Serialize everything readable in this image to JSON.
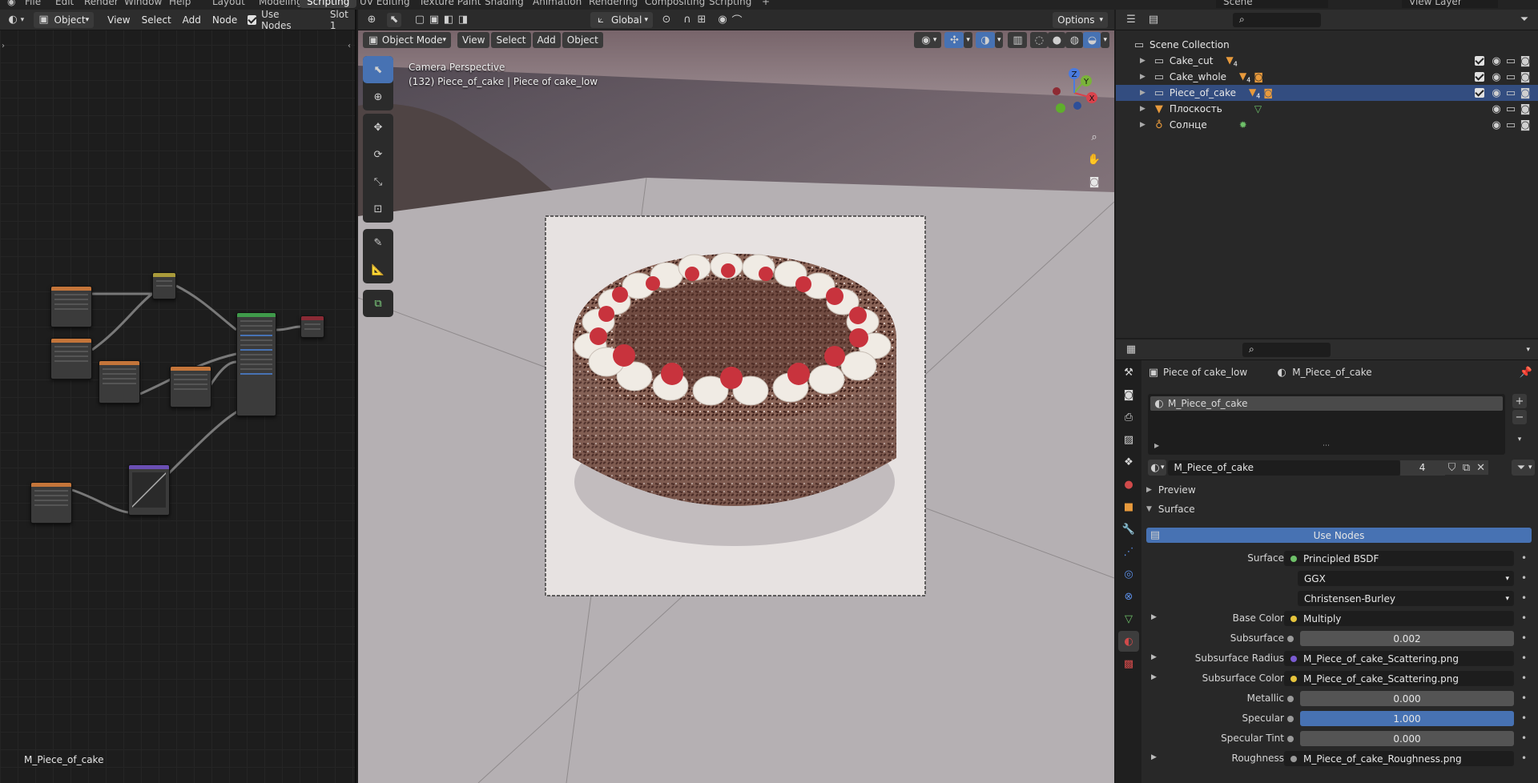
{
  "workspace_tabs": [
    "File",
    "Edit",
    "Render",
    "Window",
    "Help",
    "Layout",
    "Modeling",
    "Scripting",
    "UV Editing",
    "Texture Paint",
    "Shading",
    "Animation",
    "Rendering",
    "Compositing",
    "Scripting",
    "+"
  ],
  "scene_name": "Scene",
  "view_layer": "View Layer",
  "node_editor": {
    "object_label": "Object",
    "menus": [
      "View",
      "Select",
      "Add",
      "Node"
    ],
    "use_nodes_label": "Use Nodes",
    "slot_label": "Slot 1",
    "material_name": "M_Piece_of_cake"
  },
  "viewport": {
    "transform_orientation": "Global",
    "options_label": "Options",
    "mode": "Object Mode",
    "menus": [
      "View",
      "Select",
      "Add",
      "Object"
    ],
    "camera_title": "Camera Perspective",
    "camera_subtitle": "(132) Piece_of_cake | Piece of cake_low",
    "gizmo_axes": [
      "X",
      "Y",
      "Z"
    ]
  },
  "outliner": {
    "root": "Scene Collection",
    "items": [
      {
        "label": "Cake_cut",
        "badge": "4",
        "selected": false
      },
      {
        "label": "Cake_whole",
        "badge": "4",
        "selected": false
      },
      {
        "label": "Piece_of_cake",
        "badge": "4",
        "selected": true
      },
      {
        "label": "Плоскость",
        "badge": "",
        "selected": false
      },
      {
        "label": "Солнце",
        "badge": "",
        "selected": false
      }
    ]
  },
  "properties": {
    "breadcrumb_object": "Piece of cake_low",
    "breadcrumb_material": "M_Piece_of_cake",
    "slot_item": "M_Piece_of_cake",
    "material_name": "M_Piece_of_cake",
    "user_count": "4",
    "preview_label": "Preview",
    "surface_panel_label": "Surface",
    "use_nodes_button": "Use Nodes",
    "rows": [
      {
        "label": "Surface",
        "value": "Principled BSDF",
        "dot": "#6ec169",
        "kind": "dark"
      },
      {
        "label": "",
        "value": "GGX",
        "dot": "",
        "kind": "dark-select"
      },
      {
        "label": "",
        "value": "Christensen-Burley",
        "dot": "",
        "kind": "dark-select"
      },
      {
        "label": "Base Color",
        "value": "Multiply",
        "dot": "#e6c43c",
        "kind": "dark"
      },
      {
        "label": "Subsurface",
        "value": "0.002",
        "dot": "#9a9a9a",
        "kind": "num"
      },
      {
        "label": "Subsurface Radius",
        "value": "M_Piece_of_cake_Scattering.png",
        "dot": "#7a5bd1",
        "kind": "dark"
      },
      {
        "label": "Subsurface Color",
        "value": "M_Piece_of_cake_Scattering.png",
        "dot": "#e6c43c",
        "kind": "dark"
      },
      {
        "label": "Metallic",
        "value": "0.000",
        "dot": "#9a9a9a",
        "kind": "num"
      },
      {
        "label": "Specular",
        "value": "1.000",
        "dot": "#9a9a9a",
        "kind": "blue"
      },
      {
        "label": "Specular Tint",
        "value": "0.000",
        "dot": "#9a9a9a",
        "kind": "num"
      },
      {
        "label": "Roughness",
        "value": "M_Piece_of_cake_Roughness.png",
        "dot": "#9a9a9a",
        "kind": "dark"
      }
    ]
  }
}
